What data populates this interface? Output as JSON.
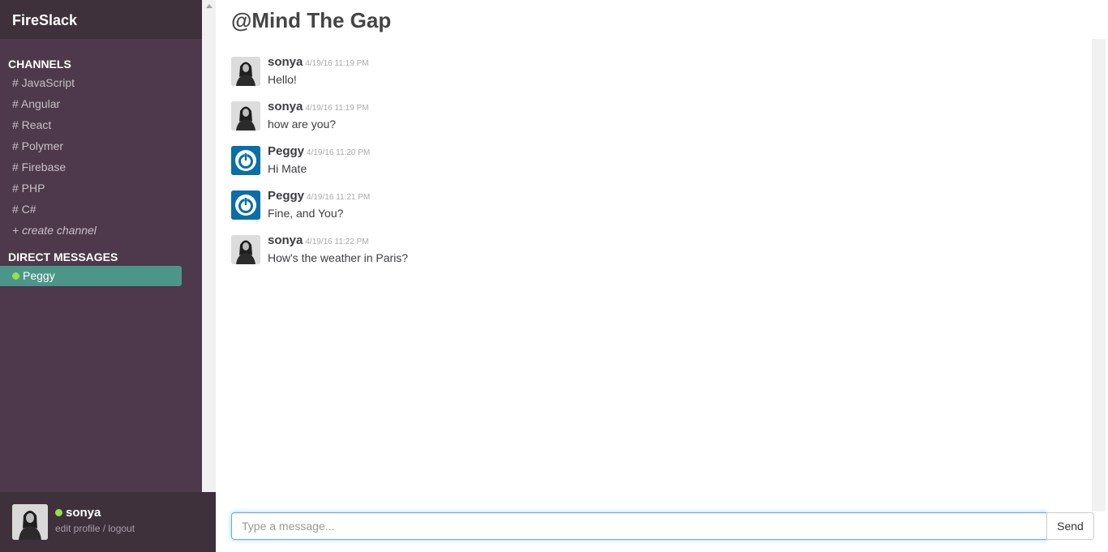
{
  "app": {
    "brand": "FireSlack"
  },
  "sidebar": {
    "channels_title": "CHANNELS",
    "channels": [
      {
        "label": "# JavaScript"
      },
      {
        "label": "# Angular"
      },
      {
        "label": "# React"
      },
      {
        "label": "# Polymer"
      },
      {
        "label": "# Firebase"
      },
      {
        "label": "# PHP"
      },
      {
        "label": "# C#"
      }
    ],
    "create_channel": "+ create channel",
    "dm_title": "DIRECT MESSAGES",
    "direct_messages": [
      {
        "label": "Peggy",
        "status": "online"
      }
    ]
  },
  "footer": {
    "user_name": "sonya",
    "links": "edit profile / logout"
  },
  "main": {
    "title": "@Mind The Gap",
    "messages": [
      {
        "author": "sonya",
        "time": "4/19/16 11:19 PM",
        "text": "Hello!",
        "avatar": "photo"
      },
      {
        "author": "sonya",
        "time": "4/19/16 11:19 PM",
        "text": "how are you?",
        "avatar": "photo"
      },
      {
        "author": "Peggy",
        "time": "4/19/16 11:20 PM",
        "text": "Hi Mate",
        "avatar": "power-icon"
      },
      {
        "author": "Peggy",
        "time": "4/19/16 11:21 PM",
        "text": "Fine, and You?",
        "avatar": "power-icon"
      },
      {
        "author": "sonya",
        "time": "4/19/16 11:22 PM",
        "text": "How's the weather in Paris?",
        "avatar": "photo"
      }
    ],
    "input": {
      "placeholder": "Type a message...",
      "value": ""
    },
    "send_label": "Send"
  },
  "colors": {
    "sidebar_bg": "#4d394b",
    "header_bg": "#3e313c",
    "active_dm": "#4c9689",
    "online_dot": "#94e048",
    "power_avatar": "#0a6ea7"
  }
}
